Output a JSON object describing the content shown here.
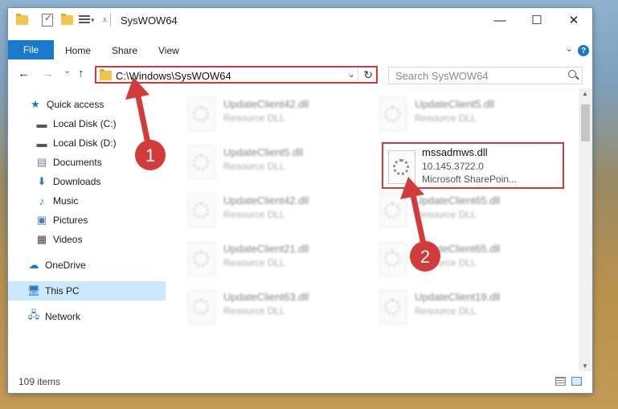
{
  "window": {
    "title": "SysWOW64",
    "controls": {
      "minimize": "—",
      "maximize": "☐",
      "close": "✕"
    }
  },
  "ribbon": {
    "tabs": [
      "File",
      "Home",
      "Share",
      "View"
    ],
    "help": "?"
  },
  "nav": {
    "back": "←",
    "forward": "→",
    "recent": "⌄",
    "up": "↑",
    "address": "C:\\Windows\\SysWOW64",
    "search_placeholder": "Search SysWOW64"
  },
  "sidebar": {
    "items": [
      {
        "label": "Quick access",
        "icon": "star-icon"
      },
      {
        "label": "Local Disk (C:)",
        "icon": "drive-icon",
        "pinned": true
      },
      {
        "label": "Local Disk (D:)",
        "icon": "drive-icon",
        "pinned": true
      },
      {
        "label": "Documents",
        "icon": "documents-icon",
        "pinned": true
      },
      {
        "label": "Downloads",
        "icon": "downloads-icon",
        "pinned": true
      },
      {
        "label": "Music",
        "icon": "music-icon",
        "pinned": true
      },
      {
        "label": "Pictures",
        "icon": "pictures-icon",
        "pinned": true
      },
      {
        "label": "Videos",
        "icon": "videos-icon",
        "pinned": true
      },
      {
        "label": "OneDrive",
        "icon": "onedrive-icon"
      },
      {
        "label": "This PC",
        "icon": "pc-icon",
        "selected": true
      },
      {
        "label": "Network",
        "icon": "network-icon"
      }
    ]
  },
  "files": {
    "left_column": [
      {
        "name": "UpdateClient42.dll",
        "desc": "Resource DLL"
      },
      {
        "name": "UpdateClient5.dll",
        "desc": "Resource DLL"
      },
      {
        "name": "UpdateClient42.dll",
        "desc": "Resource DLL"
      },
      {
        "name": "UpdateClient21.dll",
        "desc": "Resource DLL"
      },
      {
        "name": "UpdateClient63.dll",
        "desc": "Resource DLL"
      }
    ],
    "right_column": [
      {
        "name": "UpdateClient5.dll",
        "desc": "Resource DLL"
      },
      {
        "name": "UpdateClient65.dll",
        "desc": "Resource DLL"
      },
      {
        "name": "UpdateClient65.dll",
        "desc": "Resource DLL"
      },
      {
        "name": "UpdateClient19.dll",
        "desc": "Resource DLL"
      }
    ],
    "highlighted": {
      "name": "mssadmws.dll",
      "version": "10.145.3722.0",
      "description": "Microsoft SharePoin..."
    }
  },
  "annotations": {
    "step1": "1",
    "step2": "2",
    "color": "#d33b3b"
  },
  "status": {
    "item_count": "109 items"
  }
}
